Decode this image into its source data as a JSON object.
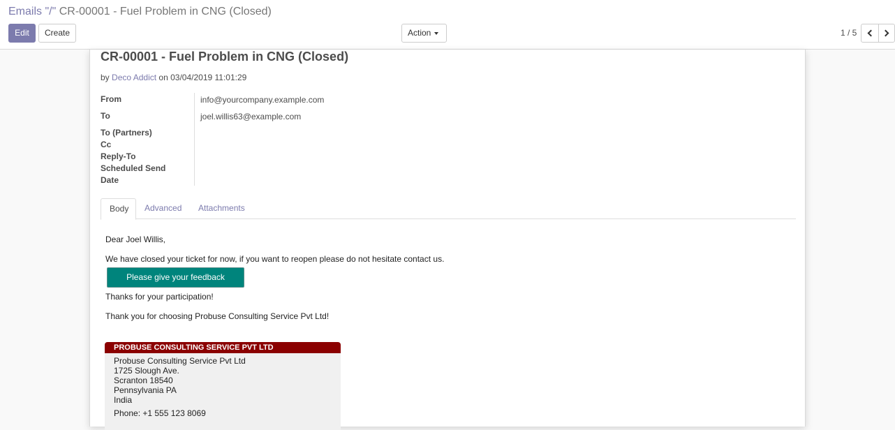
{
  "breadcrumb": {
    "parent": "Emails \"/\"",
    "separator": "",
    "current": "CR-00001 - Fuel Problem in CNG (Closed)"
  },
  "toolbar": {
    "edit_label": "Edit",
    "create_label": "Create",
    "action_label": "Action"
  },
  "pager": {
    "value": "1 / 5"
  },
  "record": {
    "title": "CR-00001 - Fuel Problem in CNG (Closed)",
    "by_prefix": "by",
    "author": "Deco Addict",
    "on_text": "on 03/04/2019 11:01:29"
  },
  "fields": {
    "from_label": "From",
    "from_value": "info@yourcompany.example.com",
    "to_label": "To",
    "to_value": "joel.willis63@example.com",
    "to_partners_label": "To (Partners)",
    "cc_label": "Cc",
    "reply_to_label": "Reply-To",
    "scheduled_label_1": "Scheduled Send",
    "scheduled_label_2": "Date"
  },
  "tabs": [
    {
      "label": "Body",
      "active": true
    },
    {
      "label": "Advanced",
      "active": false
    },
    {
      "label": "Attachments",
      "active": false
    }
  ],
  "body": {
    "greeting": "Dear Joel Willis,",
    "message": "We have closed your ticket for now, if you want to reopen please do not hesitate contact us.",
    "feedback_button": "Please give your feedback",
    "thanks": "Thanks for your participation!",
    "choosing": "Thank you for choosing Probuse Consulting Service Pvt Ltd!"
  },
  "signature": {
    "header": "PROBUSE CONSULTING SERVICE PVT LTD",
    "lines": [
      "Probuse Consulting Service Pvt Ltd",
      "1725 Slough Ave.",
      "Scranton 18540",
      "Pennsylvania PA",
      "India"
    ],
    "phone": "Phone:  +1 555 123 8069"
  },
  "colors": {
    "brand": "#7c7bad",
    "feedback_button": "#00847c",
    "signature_header": "#8b0000"
  }
}
